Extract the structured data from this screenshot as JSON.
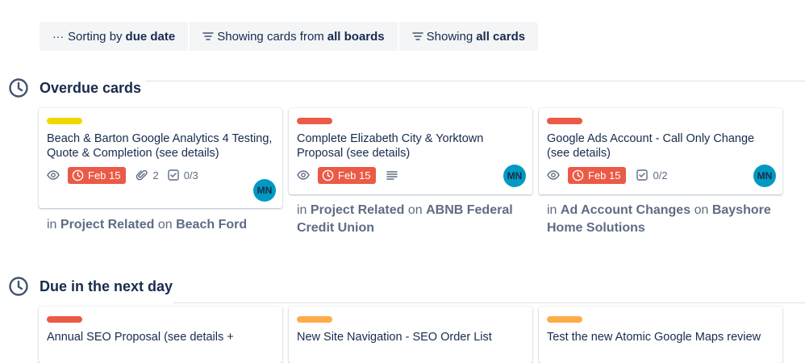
{
  "filters": {
    "sort_prefix": "Sorting by",
    "sort_value": "due date",
    "boards_prefix": "Showing cards from",
    "boards_value": "all boards",
    "cards_prefix": "Showing",
    "cards_value": "all cards"
  },
  "sections": [
    {
      "title": "Overdue cards",
      "cards": [
        {
          "label_color": "#f2d600",
          "title": "Beach & Barton Google Analytics 4 Testing, Quote & Completion (see details)",
          "due": "Feb 15",
          "attachments": "2",
          "checklist": "0/3",
          "avatar": "MN",
          "list": "Project Related",
          "board": "Beach Ford"
        },
        {
          "label_color": "#eb5a46",
          "title": "Complete Elizabeth City & Yorktown Proposal (see details)",
          "due": "Feb 15",
          "avatar": "MN",
          "list": "Project Related",
          "board": "ABNB Federal Credit Union"
        },
        {
          "label_color": "#eb5a46",
          "title": "Google Ads Account - Call Only Change (see details)",
          "due": "Feb 15",
          "checklist": "0/2",
          "avatar": "MN",
          "list": "Ad Account Changes",
          "board": "Bayshore Home Solutions"
        }
      ]
    },
    {
      "title": "Due in the next day",
      "cards": [
        {
          "label_color": "#eb5a46",
          "title": "Annual SEO Proposal (see details +"
        },
        {
          "label_color": "#ffab4a",
          "title": "New Site Navigation - SEO Order List"
        },
        {
          "label_color": "#ffab4a",
          "title": "Test the new Atomic Google Maps review"
        }
      ]
    }
  ],
  "meta_words": {
    "in": "in",
    "on": "on"
  },
  "colors": {
    "due_badge": "#eb5a46",
    "avatar": "#0099c1",
    "text": "#172b4d",
    "muted": "#5e6c84"
  }
}
